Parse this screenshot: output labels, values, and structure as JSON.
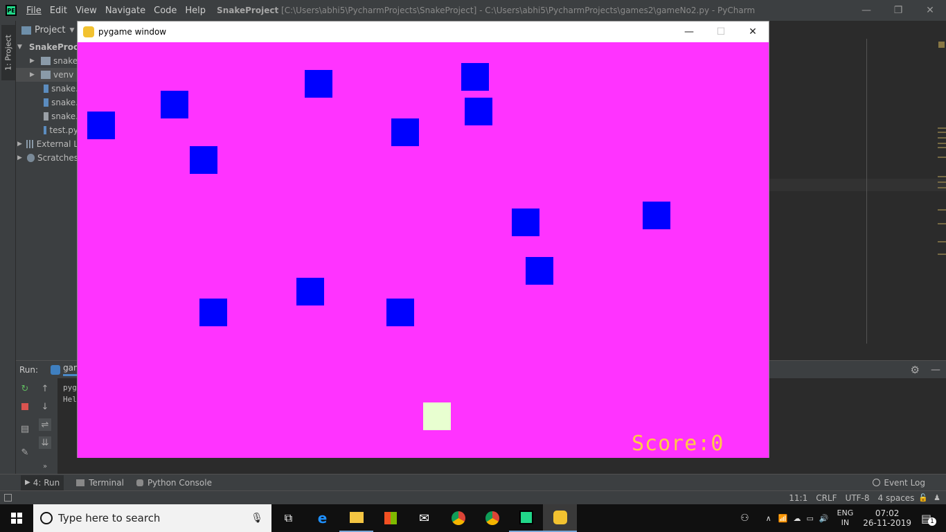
{
  "ide": {
    "logo": "PE",
    "menu": [
      "File",
      "Edit",
      "View",
      "Navigate",
      "Code",
      "Help"
    ],
    "title_project": "SnakeProject",
    "title_rest": "[C:\\Users\\abhi5\\PycharmProjects\\SnakeProject] - C:\\Users\\abhi5\\PycharmProjects\\games2\\gameNo2.py - PyCharm",
    "window_controls": {
      "minimize": "—",
      "restore": "❐",
      "close": "✕"
    },
    "side_tab": "1: Project"
  },
  "project_panel": {
    "header": "Project",
    "items": [
      {
        "label": "SnakeProc",
        "icon": "folder-icon",
        "expanded": true
      },
      {
        "label": "snake",
        "icon": "folder-icon"
      },
      {
        "label": "venv",
        "icon": "folder-icon"
      },
      {
        "label": "snake.",
        "icon": "python-file-icon"
      },
      {
        "label": "snake.",
        "icon": "python-file-icon"
      },
      {
        "label": "snake.",
        "icon": "text-file-icon"
      },
      {
        "label": "test.py",
        "icon": "python-file-icon"
      },
      {
        "label": "External L",
        "icon": "library-icon"
      },
      {
        "label": "Scratches",
        "icon": "scratches-icon"
      }
    ]
  },
  "run_panel": {
    "label": "Run:",
    "tab": "gam",
    "console": [
      "pyg",
      "Hel"
    ]
  },
  "tool_tabs": {
    "run": "4: Run",
    "terminal": "Terminal",
    "python_console": "Python Console",
    "event_log": "Event Log"
  },
  "status": {
    "position": "11:1",
    "line_sep": "CRLF",
    "encoding": "UTF-8",
    "indent": "4 spaces"
  },
  "pygame": {
    "title": "pygame window",
    "controls": {
      "minimize": "—",
      "maximize": "☐",
      "close": "✕"
    },
    "score_label": "Score:",
    "score_value": "0",
    "background": "#ff33ff",
    "block_color": "#0000ff",
    "player_color": "#e8ffd0"
  },
  "taskbar": {
    "search_placeholder": "Type here to search",
    "lang_top": "ENG",
    "lang_bottom": "IN",
    "time": "07:02",
    "date": "26-11-2019",
    "notification_count": "1"
  }
}
